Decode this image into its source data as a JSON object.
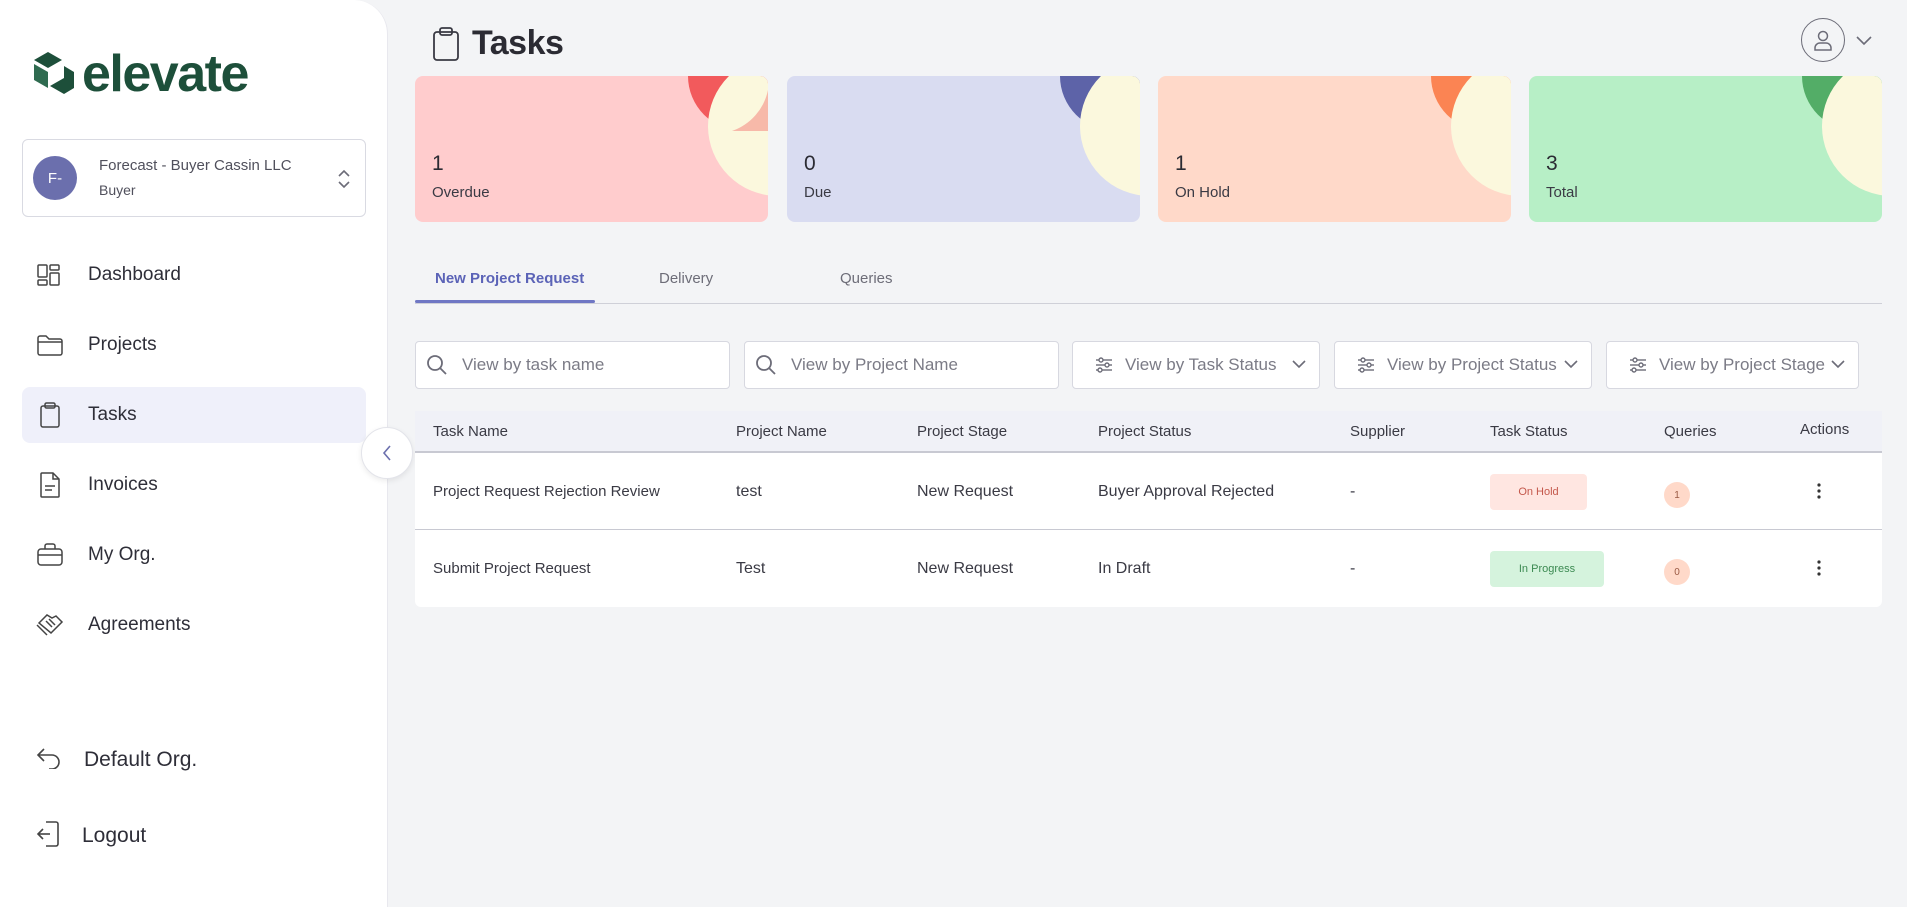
{
  "brand": {
    "name": "elevate",
    "color": "#1d4f3a"
  },
  "org": {
    "initials": "F-",
    "name": "Forecast - Buyer Cassin LLC",
    "role": "Buyer"
  },
  "nav": [
    {
      "label": "Dashboard",
      "icon": "dashboard-icon",
      "active": false
    },
    {
      "label": "Projects",
      "icon": "folder-icon",
      "active": false
    },
    {
      "label": "Tasks",
      "icon": "clipboard-icon",
      "active": true
    },
    {
      "label": "Invoices",
      "icon": "document-icon",
      "active": false
    },
    {
      "label": "My Org.",
      "icon": "briefcase-icon",
      "active": false
    },
    {
      "label": "Agreements",
      "icon": "handshake-icon",
      "active": false
    }
  ],
  "bottom_nav": [
    {
      "label": "Default Org.",
      "icon": "undo-arrow-icon"
    },
    {
      "label": "Logout",
      "icon": "logout-icon"
    }
  ],
  "header": {
    "title": "Tasks"
  },
  "stats": [
    {
      "value": "1",
      "label": "Overdue",
      "bg": "#ffcccd",
      "accent": "#f25a5c"
    },
    {
      "value": "0",
      "label": "Due",
      "bg": "#d9dcf1",
      "accent": "#5d63a8"
    },
    {
      "value": "1",
      "label": "On Hold",
      "bg": "#ffd9c9",
      "accent": "#fb8453"
    },
    {
      "value": "3",
      "label": "Total",
      "bg": "#b7efc6",
      "accent": "#53ad67"
    }
  ],
  "tabs": [
    {
      "label": "New Project Request",
      "active": true
    },
    {
      "label": "Delivery",
      "active": false
    },
    {
      "label": "Queries",
      "active": false
    }
  ],
  "filters": {
    "task_name_placeholder": "View by task name",
    "project_name_placeholder": "View by Project Name",
    "task_status": "View by Task Status",
    "project_status": "View by Project Status",
    "project_stage": "View by Project Stage"
  },
  "table": {
    "columns": [
      "Task Name",
      "Project Name",
      "Project Stage",
      "Project Status",
      "Supplier",
      "Task Status",
      "Queries",
      "Actions"
    ],
    "rows": [
      {
        "task_name": "Project Request Rejection Review",
        "project_name": "test",
        "project_stage": "New Request",
        "project_status": "Buyer Approval Rejected",
        "supplier": "-",
        "task_status": "On Hold",
        "status_bg": "#ffe6e1",
        "status_color": "#c4584b",
        "queries": "1"
      },
      {
        "task_name": "Submit Project Request",
        "project_name": "Test",
        "project_stage": "New Request",
        "project_status": "In Draft",
        "supplier": "-",
        "task_status": "In Progress",
        "status_bg": "#d5f3dd",
        "status_color": "#3c8a52",
        "queries": "0"
      }
    ]
  }
}
